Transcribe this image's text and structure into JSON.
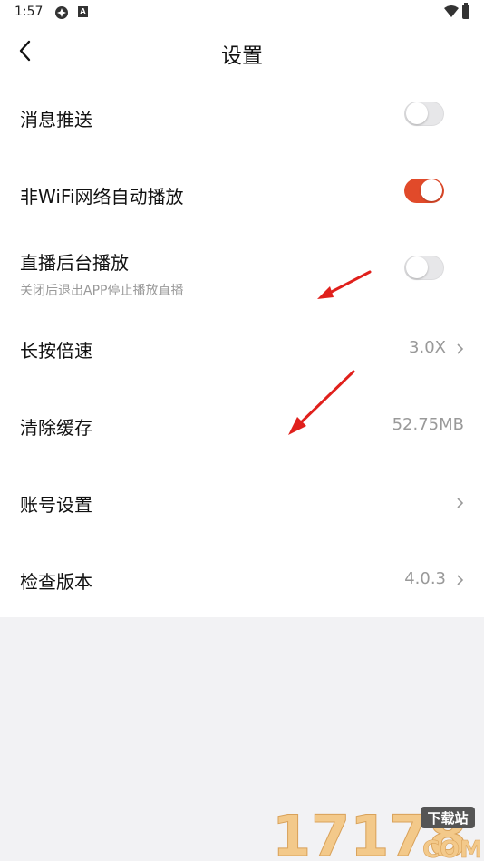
{
  "status_bar": {
    "time": "1:57",
    "a_icon": "A"
  },
  "header": {
    "title": "设置"
  },
  "settings": {
    "push": {
      "label": "消息推送",
      "enabled": false
    },
    "autoplay": {
      "label": "非WiFi网络自动播放",
      "enabled": true
    },
    "background": {
      "label": "直播后台播放",
      "sub": "关闭后退出APP停止播放直播",
      "enabled": false
    },
    "speed": {
      "label": "长按倍速",
      "value": "3.0X"
    },
    "cache": {
      "label": "清除缓存",
      "value": "52.75MB"
    },
    "account": {
      "label": "账号设置"
    },
    "version": {
      "label": "检查版本",
      "value": "4.0.3"
    }
  },
  "colors": {
    "accent": "#e14a2a",
    "arrow": "#e0201c"
  },
  "watermark": {
    "number": "17178",
    "tag": "下载站",
    "domain": "COM"
  }
}
